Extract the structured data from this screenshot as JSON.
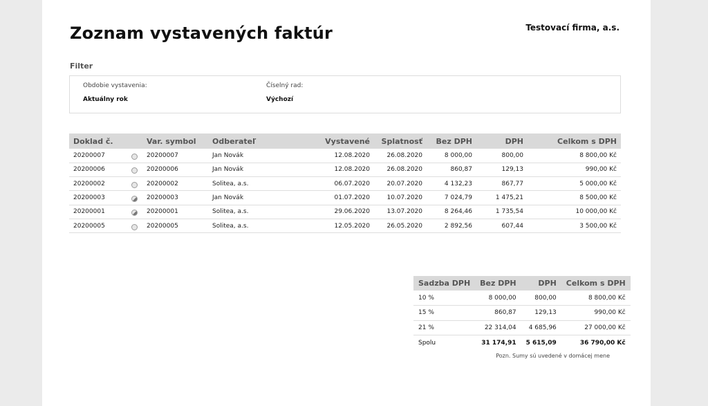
{
  "header": {
    "title": "Zoznam vystavených faktúr",
    "company": "Testovací firma, a.s."
  },
  "filter": {
    "label": "Filter",
    "period_label": "Obdobie vystavenia:",
    "period_value": "Aktuálny rok",
    "series_label": "Číselný rad:",
    "series_value": "Výchozí"
  },
  "invoices": {
    "columns": [
      "Doklad č.",
      "",
      "Var. symbol",
      "Odberateľ",
      "Vystavené",
      "Splatnosť",
      "Bez DPH",
      "DPH",
      "Celkom s DPH"
    ],
    "rows": [
      {
        "doc": "20200007",
        "status": "unpaid",
        "vs": "20200007",
        "customer": "Jan Novák",
        "issued": "12.08.2020",
        "due": "26.08.2020",
        "net": "8 000,00",
        "vat": "800,00",
        "total": "8 800,00 Kč"
      },
      {
        "doc": "20200006",
        "status": "unpaid",
        "vs": "20200006",
        "customer": "Jan Novák",
        "issued": "12.08.2020",
        "due": "26.08.2020",
        "net": "860,87",
        "vat": "129,13",
        "total": "990,00 Kč"
      },
      {
        "doc": "20200002",
        "status": "unpaid",
        "vs": "20200002",
        "customer": "Solitea, a.s.",
        "issued": "06.07.2020",
        "due": "20.07.2020",
        "net": "4 132,23",
        "vat": "867,77",
        "total": "5 000,00 Kč"
      },
      {
        "doc": "20200003",
        "status": "partial",
        "vs": "20200003",
        "customer": "Jan Novák",
        "issued": "01.07.2020",
        "due": "10.07.2020",
        "net": "7 024,79",
        "vat": "1 475,21",
        "total": "8 500,00 Kč"
      },
      {
        "doc": "20200001",
        "status": "partial",
        "vs": "20200001",
        "customer": "Solitea, a.s.",
        "issued": "29.06.2020",
        "due": "13.07.2020",
        "net": "8 264,46",
        "vat": "1 735,54",
        "total": "10 000,00 Kč"
      },
      {
        "doc": "20200005",
        "status": "unpaid",
        "vs": "20200005",
        "customer": "Solitea, a.s.",
        "issued": "12.05.2020",
        "due": "26.05.2020",
        "net": "2 892,56",
        "vat": "607,44",
        "total": "3 500,00 Kč"
      }
    ]
  },
  "summary": {
    "columns": [
      "Sadzba DPH",
      "Bez DPH",
      "DPH",
      "Celkom s DPH"
    ],
    "rows": [
      {
        "rate": "10 %",
        "net": "8 000,00",
        "vat": "800,00",
        "total": "8 800,00 Kč"
      },
      {
        "rate": "15 %",
        "net": "860,87",
        "vat": "129,13",
        "total": "990,00 Kč"
      },
      {
        "rate": "21 %",
        "net": "22 314,04",
        "vat": "4 685,96",
        "total": "27 000,00 Kč"
      }
    ],
    "total": {
      "rate": "Spolu",
      "net": "31 174,91",
      "vat": "5 615,09",
      "total": "36 790,00 Kč"
    },
    "note": "Pozn. Sumy sú uvedené v domácej mene"
  }
}
